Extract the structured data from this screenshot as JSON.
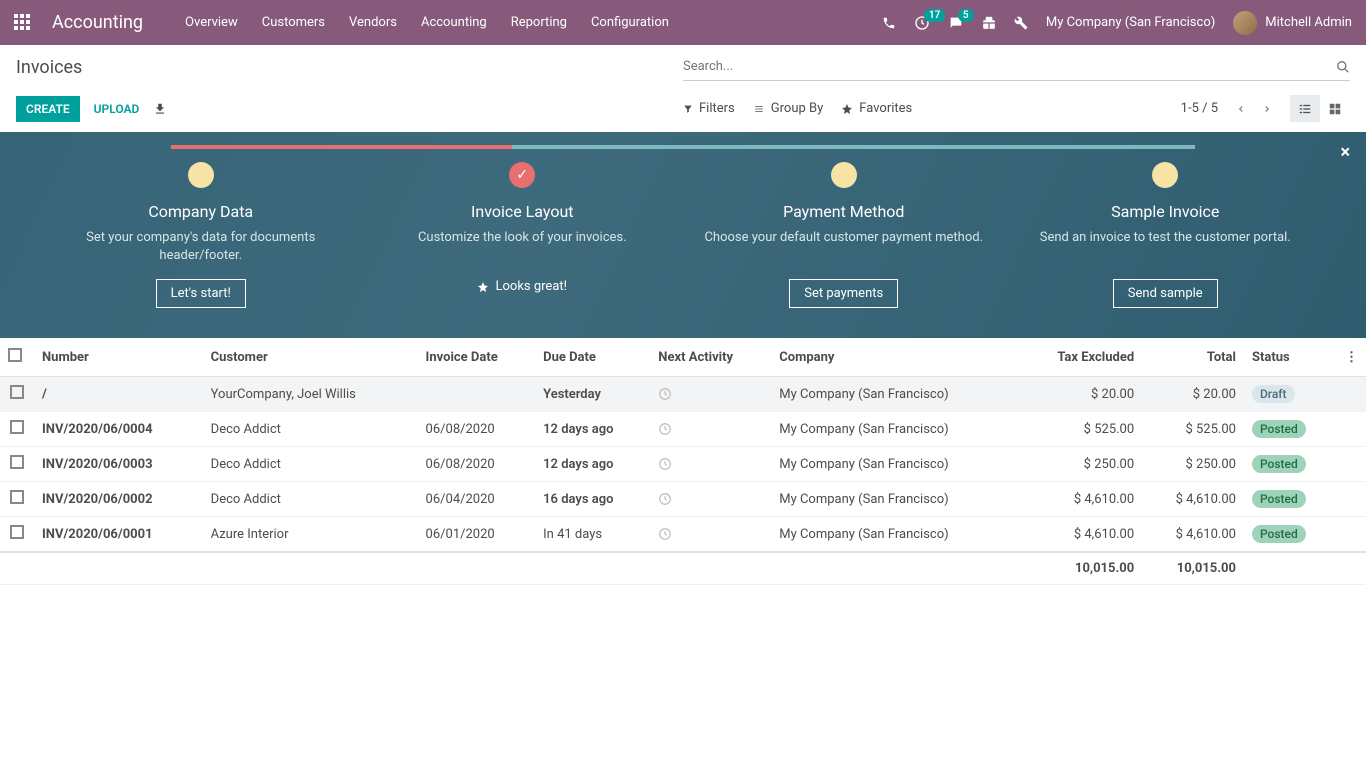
{
  "topnav": {
    "brand": "Accounting",
    "menu": [
      "Overview",
      "Customers",
      "Vendors",
      "Accounting",
      "Reporting",
      "Configuration"
    ],
    "activities_badge": "17",
    "discuss_badge": "5",
    "company": "My Company (San Francisco)",
    "user": "Mitchell Admin"
  },
  "control": {
    "title": "Invoices",
    "search_placeholder": "Search...",
    "create": "CREATE",
    "upload": "UPLOAD",
    "filters": "Filters",
    "groupby": "Group By",
    "favorites": "Favorites",
    "pager": "1-5 / 5"
  },
  "onboarding": {
    "steps": [
      {
        "title": "Company Data",
        "desc": "Set your company's data for documents header/footer.",
        "action": "Let's start!",
        "done": false
      },
      {
        "title": "Invoice Layout",
        "desc": "Customize the look of your invoices.",
        "looks": "Looks great!",
        "done": true
      },
      {
        "title": "Payment Method",
        "desc": "Choose your default customer payment method.",
        "action": "Set payments",
        "done": false
      },
      {
        "title": "Sample Invoice",
        "desc": "Send an invoice to test the customer portal.",
        "action": "Send sample",
        "done": false
      }
    ]
  },
  "table": {
    "headers": {
      "number": "Number",
      "customer": "Customer",
      "invoice_date": "Invoice Date",
      "due_date": "Due Date",
      "next_activity": "Next Activity",
      "company": "Company",
      "tax_excluded": "Tax Excluded",
      "total": "Total",
      "status": "Status"
    },
    "rows": [
      {
        "number": "/",
        "customer": "YourCompany, Joel Willis",
        "invoice_date": "",
        "due_date": "Yesterday",
        "due_over": true,
        "company": "My Company (San Francisco)",
        "tax_excluded": "$ 20.00",
        "total": "$ 20.00",
        "status": "Draft",
        "status_kind": "draft",
        "selected": true
      },
      {
        "number": "INV/2020/06/0004",
        "customer": "Deco Addict",
        "invoice_date": "06/08/2020",
        "due_date": "12 days ago",
        "due_over": true,
        "company": "My Company (San Francisco)",
        "tax_excluded": "$ 525.00",
        "total": "$ 525.00",
        "status": "Posted",
        "status_kind": "posted"
      },
      {
        "number": "INV/2020/06/0003",
        "customer": "Deco Addict",
        "invoice_date": "06/08/2020",
        "due_date": "12 days ago",
        "due_over": true,
        "company": "My Company (San Francisco)",
        "tax_excluded": "$ 250.00",
        "total": "$ 250.00",
        "status": "Posted",
        "status_kind": "posted"
      },
      {
        "number": "INV/2020/06/0002",
        "customer": "Deco Addict",
        "invoice_date": "06/04/2020",
        "due_date": "16 days ago",
        "due_over": true,
        "company": "My Company (San Francisco)",
        "tax_excluded": "$ 4,610.00",
        "total": "$ 4,610.00",
        "status": "Posted",
        "status_kind": "posted"
      },
      {
        "number": "INV/2020/06/0001",
        "customer": "Azure Interior",
        "invoice_date": "06/01/2020",
        "due_date": "In 41 days",
        "due_over": false,
        "company": "My Company (San Francisco)",
        "tax_excluded": "$ 4,610.00",
        "total": "$ 4,610.00",
        "status": "Posted",
        "status_kind": "posted"
      }
    ],
    "totals": {
      "tax_excluded": "10,015.00",
      "total": "10,015.00"
    }
  }
}
